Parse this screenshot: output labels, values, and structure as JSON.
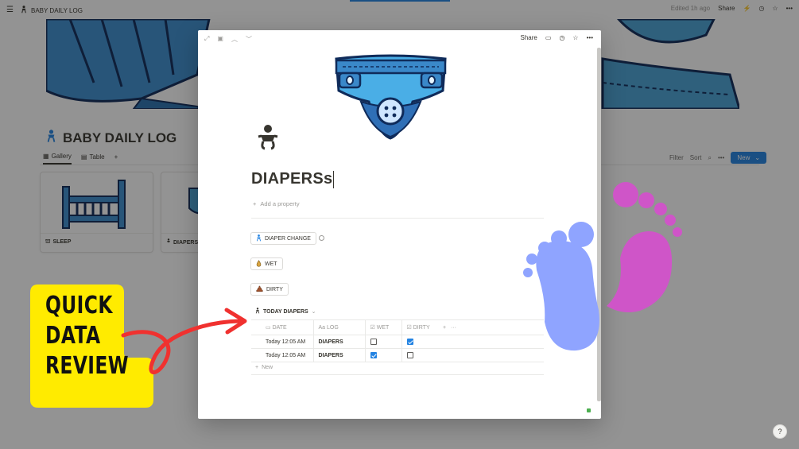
{
  "topbar": {
    "breadcrumb": "BABY DAILY LOG",
    "edited": "Edited 1h ago",
    "share": "Share"
  },
  "page": {
    "title": "BABY DAILY LOG",
    "tabs": [
      {
        "label": "Gallery",
        "active": true
      },
      {
        "label": "Table",
        "active": false
      }
    ],
    "tools": {
      "filter": "Filter",
      "sort": "Sort",
      "new": "New"
    },
    "cards": [
      {
        "label": "SLEEP"
      },
      {
        "label": "DIAPERS"
      }
    ]
  },
  "modal": {
    "share": "Share",
    "title": "DIAPERSs",
    "add_property": "Add a property",
    "buttons": [
      {
        "label": "DIAPER CHANGE",
        "icon": "baby-icon"
      },
      {
        "label": "WET",
        "icon": "drop-icon"
      },
      {
        "label": "DIRTY",
        "icon": "poop-icon"
      }
    ],
    "database": {
      "title": "TODAY DIAPERS",
      "columns": [
        "DATE",
        "LOG",
        "WET",
        "DIRTY"
      ],
      "log_prefix": "Aa",
      "rows": [
        {
          "date": "Today 12:05 AM",
          "log": "DIAPERS",
          "wet": false,
          "dirty": true
        },
        {
          "date": "Today 12:05 AM",
          "log": "DIAPERS",
          "wet": true,
          "dirty": false
        }
      ],
      "new_label": "New"
    }
  },
  "overlay": {
    "quick_lines": [
      "QUICK",
      "DATA",
      "REVIEW"
    ],
    "yellow": "#ffeb00",
    "arrow_color": "#f0312f",
    "foot_blue": "#8fa4ff",
    "foot_pink": "#cf55c8"
  },
  "help": "?"
}
